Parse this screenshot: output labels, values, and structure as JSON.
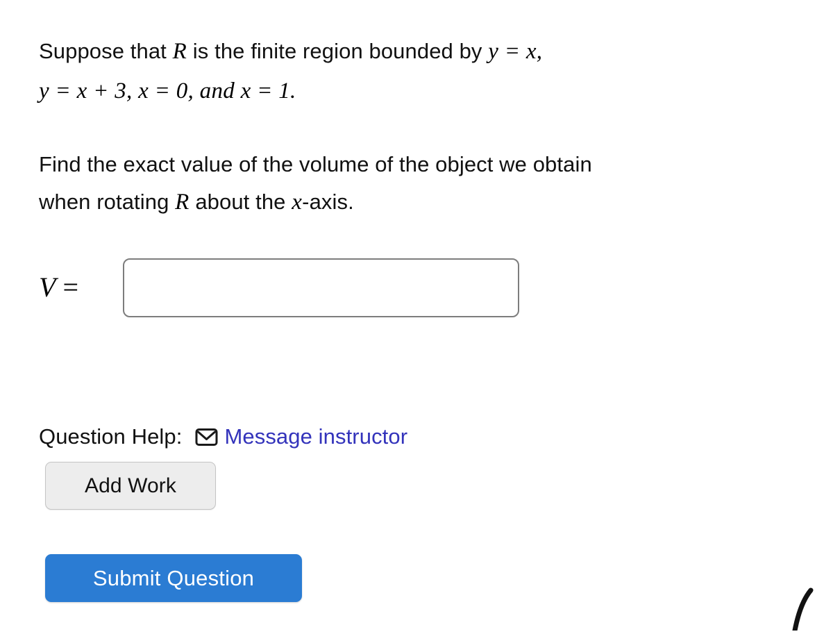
{
  "problem": {
    "statement_line1_prefix": "Suppose that ",
    "statement_R": "R",
    "statement_line1_mid": " is the finite region bounded by ",
    "statement_eq_y_equals_x": "y = x,",
    "statement_line2_eq1": "y = x + 3,",
    "statement_line2_eq2": "x = 0,",
    "statement_line2_and": " and ",
    "statement_line2_eq3": "x = 1.",
    "statement_line2_full": "y = x + 3, x = 0, and x = 1.",
    "prompt_part1": "Find the exact value of the volume of the object we obtain",
    "prompt_part2_prefix": "when rotating ",
    "prompt_R": "R",
    "prompt_part2_mid": " about the ",
    "prompt_x": "x",
    "prompt_part2_suffix": "-axis."
  },
  "answer": {
    "label_variable": "V",
    "label_equals": "=",
    "value": "",
    "placeholder": ""
  },
  "help": {
    "label": "Question Help:",
    "message_instructor_label": "Message instructor",
    "envelope_icon": "envelope-icon"
  },
  "buttons": {
    "add_work": "Add Work",
    "submit_question": "Submit Question"
  },
  "colors": {
    "link": "#3333bb",
    "submit_button_bg": "#2b7cd3",
    "submit_button_text": "#ffffff",
    "add_work_bg": "#ededed",
    "input_border": "#7d7d7d",
    "text": "#111111"
  }
}
